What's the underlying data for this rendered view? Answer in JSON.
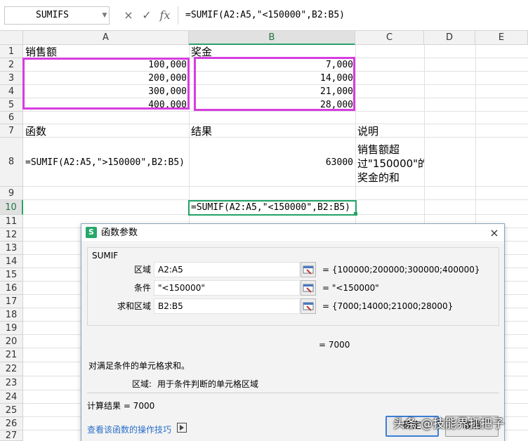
{
  "formula_bar": {
    "name_box": "SUMIFS",
    "cancel_glyph": "×",
    "confirm_glyph": "✓",
    "fx_label": "fx",
    "formula": "=SUMIF(A2:A5,\"<150000\",B2:B5)"
  },
  "columns": [
    "A",
    "B",
    "C",
    "D",
    "E"
  ],
  "rows": [
    "1",
    "2",
    "3",
    "4",
    "5",
    "6",
    "7",
    "8",
    "9",
    "10",
    "11",
    "12",
    "13",
    "14",
    "15",
    "16",
    "17",
    "18",
    "19",
    "20",
    "21",
    "22",
    "23",
    "24",
    "25",
    "26",
    "27"
  ],
  "selected_column": "B",
  "selected_row": "10",
  "cells": {
    "A1": "销售额",
    "B1": "奖金",
    "A2": "100,000",
    "B2": "7,000",
    "A3": "200,000",
    "B3": "14,000",
    "A4": "300,000",
    "B4": "21,000",
    "A5": "400,000",
    "B5": "28,000",
    "A7": "函数",
    "B7": "结果",
    "C7": "说明",
    "A8": "=SUMIF(A2:A5,\">150000\",B2:B5)",
    "B8": "63000",
    "C8": "销售额超过\"150000\"的奖金的和",
    "B10": "=SUMIF(A2:A5,\"<150000\",B2:B5)"
  },
  "highlight_color": "#d63de0",
  "accent_color": "#21a366",
  "dialog": {
    "title": "函数参数",
    "logo": "S",
    "close_glyph": "×",
    "function_name": "SUMIF",
    "args": [
      {
        "label": "区域",
        "value": "A2:A5",
        "result": "= {100000;200000;300000;400000}"
      },
      {
        "label": "条件",
        "value": "\"<150000\"",
        "result": "= \"<150000\""
      },
      {
        "label": "求和区域",
        "value": "B2:B5",
        "result": "= {7000;14000;21000;28000}"
      }
    ],
    "function_result": "= 7000",
    "description": "对满足条件的单元格求和。",
    "arg_help_label": "区域:",
    "arg_help_text": "用于条件判断的单元格区域",
    "calc_result": "计算结果 = 7000",
    "help_link": "查看该函数的操作技巧",
    "ok_label": "确定",
    "cancel_label": "取消"
  },
  "watermark": "头条 @技能界扛把子"
}
